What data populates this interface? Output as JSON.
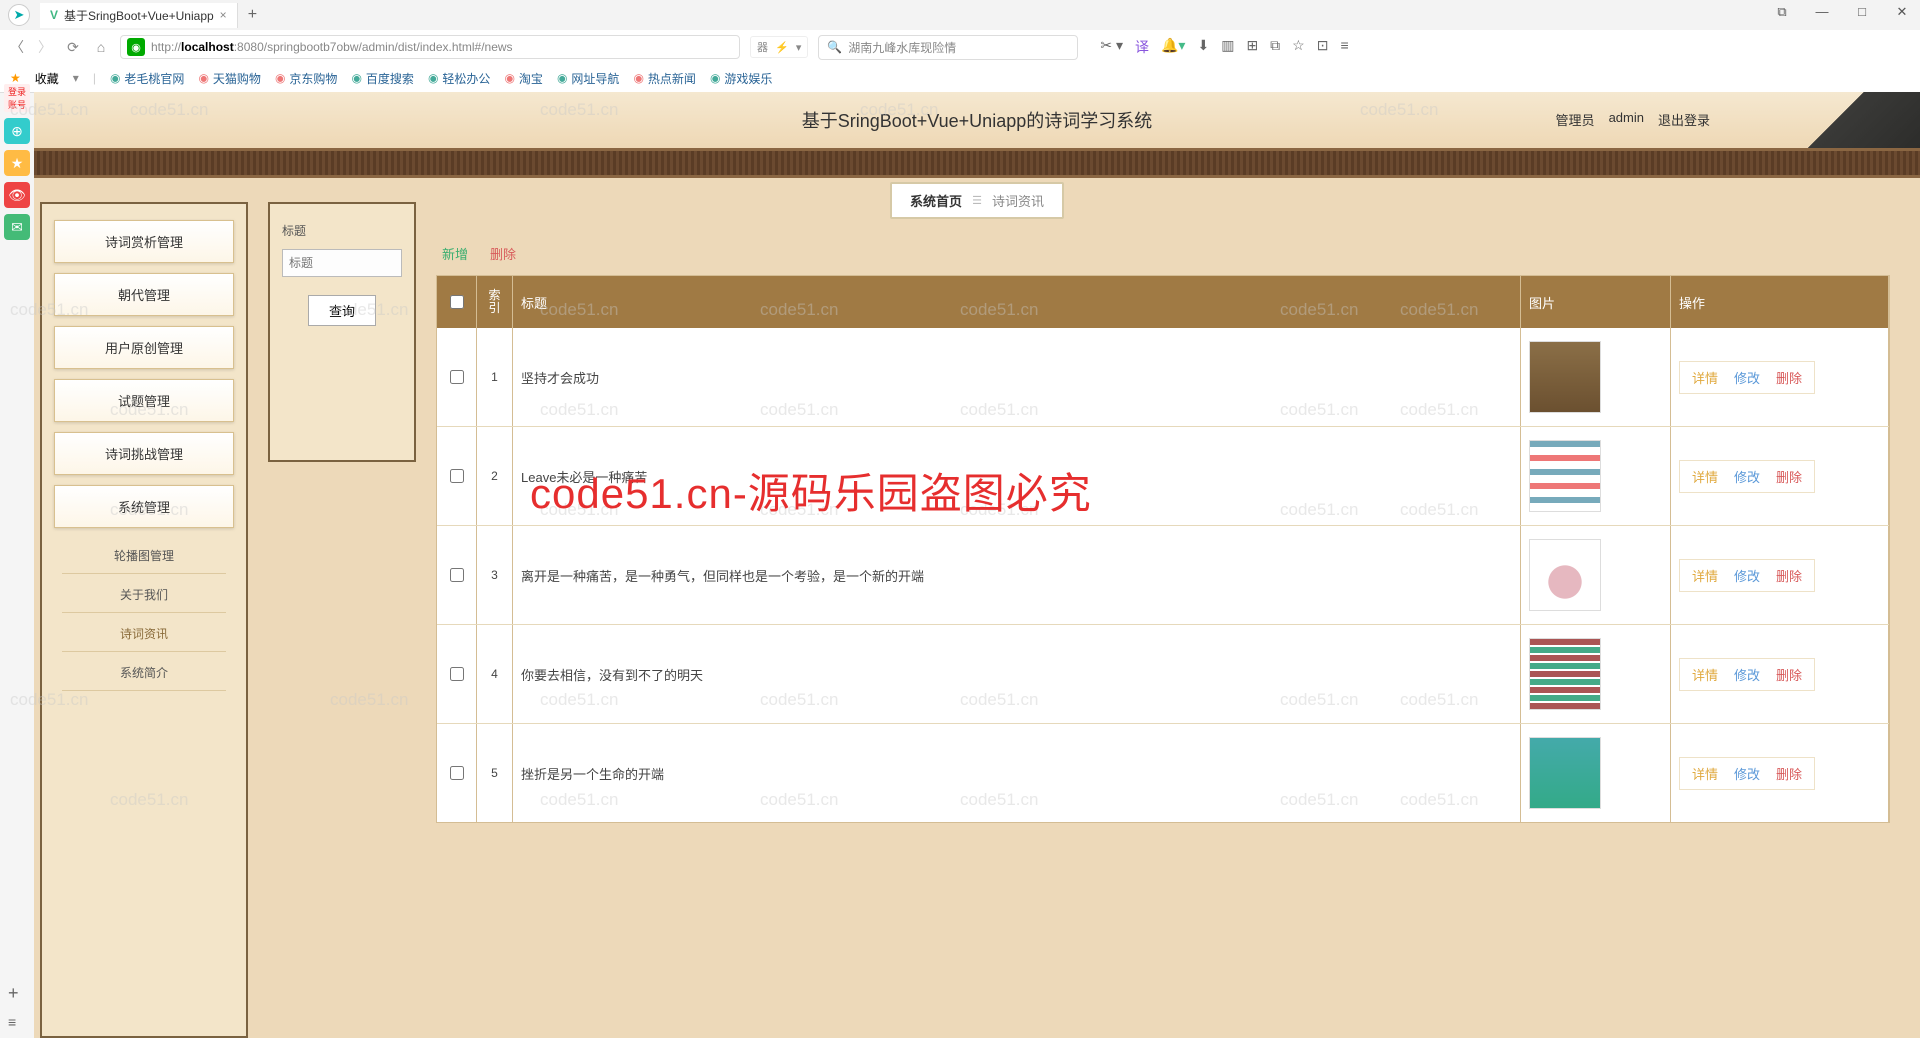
{
  "browser": {
    "tab_title": "基于SringBoot+Vue+Uniapp",
    "url_prefix": "http://",
    "url_host": "localhost",
    "url_rest": ":8080/springbootb7obw/admin/dist/index.html#/news",
    "search_placeholder": "湖南九峰水库现险情",
    "bookmarks_label": "收藏",
    "bookmarks": [
      "老毛桃官网",
      "天猫购物",
      "京东购物",
      "百度搜索",
      "轻松办公",
      "淘宝",
      "网址导航",
      "热点新闻",
      "游戏娱乐"
    ]
  },
  "header": {
    "title": "基于SringBoot+Vue+Uniapp的诗词学习系统",
    "role": "管理员",
    "user": "admin",
    "logout": "退出登录"
  },
  "breadcrumb": {
    "home": "系统首页",
    "current": "诗词资讯"
  },
  "sidebar": {
    "main": [
      "诗词赏析管理",
      "朝代管理",
      "用户原创管理",
      "试题管理",
      "诗词挑战管理",
      "系统管理"
    ],
    "sub": [
      "轮播图管理",
      "关于我们",
      "诗词资讯",
      "系统简介"
    ]
  },
  "filter": {
    "label": "标题",
    "input_placeholder": "标题",
    "search_btn": "查询"
  },
  "actions": {
    "add": "新增",
    "del": "删除"
  },
  "table": {
    "head": {
      "idx1": "索",
      "idx2": "引",
      "title": "标题",
      "img": "图片",
      "ops": "操作"
    },
    "ops_labels": {
      "detail": "详情",
      "edit": "修改",
      "del": "删除"
    },
    "rows": [
      {
        "idx": "1",
        "title": "坚持才会成功"
      },
      {
        "idx": "2",
        "title": "Leave未必是一种痛苦"
      },
      {
        "idx": "3",
        "title": "离开是一种痛苦，是一种勇气，但同样也是一个考验，是一个新的开端"
      },
      {
        "idx": "4",
        "title": "你要去相信，没有到不了的明天"
      },
      {
        "idx": "5",
        "title": "挫折是另一个生命的开端"
      }
    ]
  },
  "watermark_text": "code51.cn",
  "big_watermark": "code51.cn-源码乐园盗图必究"
}
